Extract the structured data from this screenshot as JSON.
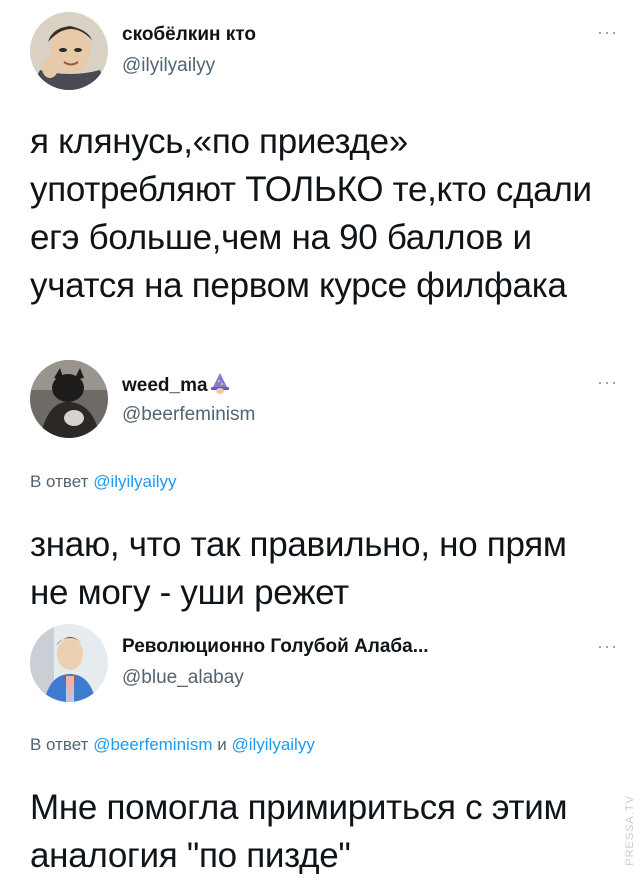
{
  "tweets": [
    {
      "name": "скобёлкин кто",
      "handle": "@ilyilyailyy",
      "text": "я клянусь,«по приезде» употребляют ТОЛЬКО те,кто сдали егэ больше,чем на 90 баллов и учатся на первом курсе филфака",
      "more": "···"
    },
    {
      "name": "weed_ma",
      "handle": "@beerfeminism",
      "reply_prefix": "В ответ",
      "reply_handles": "@ilyilyailyy",
      "text": "знаю, что так правильно, но прям не могу - уши режет",
      "more": "···",
      "badge_icon": "wizard-emoji-icon"
    },
    {
      "name": "Революционно Голубой Алаба...",
      "handle": "@blue_alabay",
      "reply_prefix": "В ответ",
      "reply_handle_1": "@beerfeminism",
      "reply_joiner": "и",
      "reply_handle_2": "@ilyilyailyy",
      "text": "Мне помогла примириться с этим аналогия \"по пизде\"",
      "more": "···"
    }
  ],
  "watermark": "PRESSA.TV"
}
